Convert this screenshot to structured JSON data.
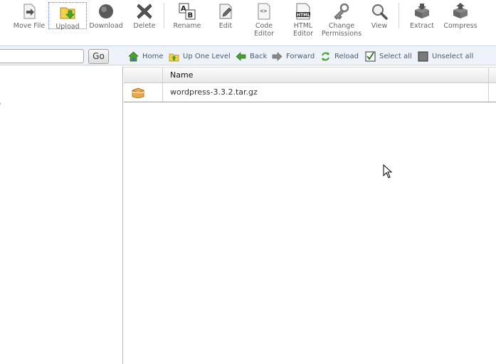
{
  "toolbar": {
    "move_file": "Move File",
    "upload": "Upload",
    "download": "Download",
    "delete": "Delete",
    "rename": "Rename",
    "edit": "Edit",
    "code_editor": [
      "Code",
      "Editor"
    ],
    "html_editor": [
      "HTML",
      "Editor"
    ],
    "change_permissions": [
      "Change",
      "Permissions"
    ],
    "view": "View",
    "extract": "Extract",
    "compress": "Compress"
  },
  "path_bar": {
    "value": "",
    "go_label": "Go"
  },
  "nav": {
    "home": "Home",
    "up_one_level": "Up One Level",
    "back": "Back",
    "forward": "Forward",
    "reload": "Reload",
    "select_all": "Select all",
    "unselect_all": "Unselect all"
  },
  "left_pane": {
    "fragment": ")"
  },
  "table": {
    "name_header": "Name",
    "rows": [
      {
        "name": "wordpress-3.3.2.tar.gz",
        "icon": "package-icon"
      }
    ]
  },
  "colors": {
    "accent_blue": "#3b6fb6",
    "green": "#4aa02c",
    "bar_bg": "#eef3f9"
  }
}
